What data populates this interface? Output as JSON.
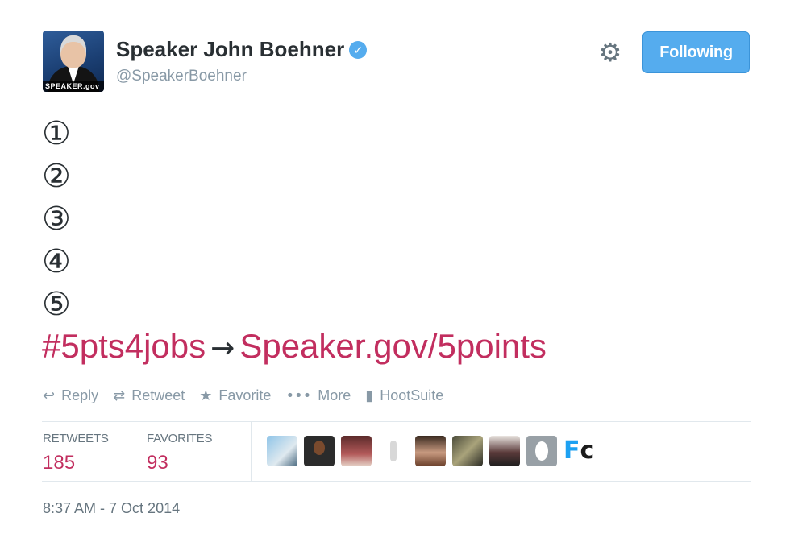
{
  "author": {
    "name": "Speaker John Boehner",
    "handle": "@SpeakerBoehner",
    "verified_glyph": "✓",
    "avatar_tag": "SPEAKER.gov"
  },
  "header": {
    "settings_icon": "⚙",
    "follow_label": "Following"
  },
  "tweet": {
    "lines": [
      "①",
      "②",
      "③",
      "④",
      "⑤"
    ],
    "hashtag": "#5pts4jobs",
    "arrow": "→",
    "link": "Speaker.gov/5points"
  },
  "actions": [
    {
      "icon": "↩",
      "label": "Reply"
    },
    {
      "icon": "⇄",
      "label": "Retweet"
    },
    {
      "icon": "★",
      "label": "Favorite"
    },
    {
      "icon": "•••",
      "label": "More"
    },
    {
      "icon": "▮",
      "label": "HootSuite"
    }
  ],
  "stats": {
    "retweets_label": "RETWEETS",
    "retweets_value": "185",
    "favorites_label": "FAVORITES",
    "favorites_value": "93"
  },
  "favoriters_last_label": "c",
  "favoriters_first_label": "F",
  "timestamp": "8:37 AM - 7 Oct 2014",
  "colors": {
    "accent": "#55acee",
    "link": "#c22e5f",
    "muted": "#8899a6"
  }
}
